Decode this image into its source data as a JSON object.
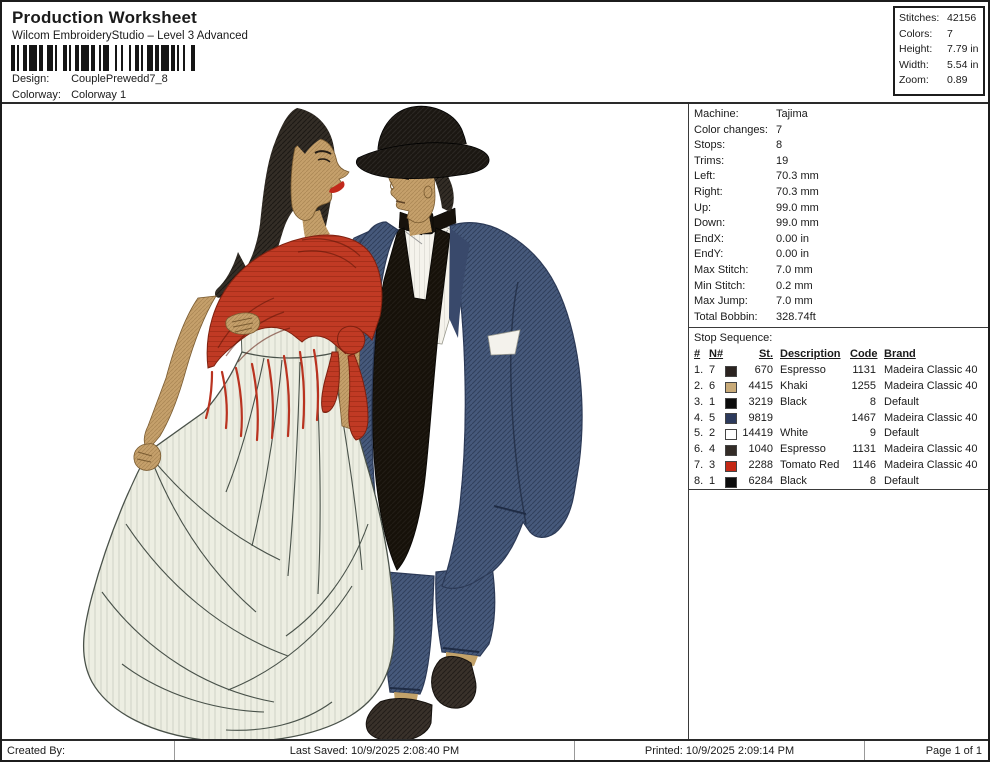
{
  "page": {
    "title": "Production Worksheet",
    "subtitle": "Wilcom EmbroideryStudio – Level 3 Advanced"
  },
  "design": {
    "label": "Design:",
    "value": "CouplePrewedd7_8"
  },
  "colorway": {
    "label": "Colorway:",
    "value": "Colorway 1"
  },
  "barcode": {
    "pattern": "2112214122311321122141221133121312211231214121121321"
  },
  "stats_box": {
    "rows": [
      {
        "label": "Stitches:",
        "value": "42156"
      },
      {
        "label": "Colors:",
        "value": "7"
      },
      {
        "label": "Height:",
        "value": "7.79 in"
      },
      {
        "label": "Width:",
        "value": "5.54 in"
      },
      {
        "label": "Zoom:",
        "value": "0.89"
      }
    ]
  },
  "machine_info": {
    "rows": [
      {
        "label": "Machine:",
        "value": "Tajima"
      },
      {
        "label": "Color changes:",
        "value": "7"
      },
      {
        "label": "Stops:",
        "value": "8"
      },
      {
        "label": "Trims:",
        "value": "19"
      },
      {
        "label": "Left:",
        "value": "70.3 mm"
      },
      {
        "label": "Right:",
        "value": "70.3 mm"
      },
      {
        "label": "Up:",
        "value": "99.0 mm"
      },
      {
        "label": "Down:",
        "value": "99.0 mm"
      },
      {
        "label": "EndX:",
        "value": "0.00 in"
      },
      {
        "label": "EndY:",
        "value": "0.00 in"
      },
      {
        "label": "Max Stitch:",
        "value": "7.0 mm"
      },
      {
        "label": "Min Stitch:",
        "value": "0.2 mm"
      },
      {
        "label": "Max Jump:",
        "value": "7.0 mm"
      },
      {
        "label": "Total Bobbin:",
        "value": "328.74ft"
      }
    ]
  },
  "stop_sequence": {
    "title": "Stop Sequence:",
    "headers": {
      "num": "#",
      "needle": "N#",
      "stitches": "St.",
      "description": "Description",
      "code": "Code",
      "brand": "Brand"
    },
    "rows": [
      {
        "num": "1.",
        "needle": "7",
        "color": "#2b2320",
        "st": "670",
        "description": "Espresso",
        "code": "1131",
        "brand": "Madeira Classic 40"
      },
      {
        "num": "2.",
        "needle": "6",
        "color": "#c8aa78",
        "st": "4415",
        "description": "Khaki",
        "code": "1255",
        "brand": "Madeira Classic 40"
      },
      {
        "num": "3.",
        "needle": "1",
        "color": "#0c0c0c",
        "st": "3219",
        "description": "Black",
        "code": "8",
        "brand": "Default"
      },
      {
        "num": "4.",
        "needle": "5",
        "color": "#2c3a5c",
        "st": "9819",
        "description": "",
        "code": "1467",
        "brand": "Madeira Classic 40"
      },
      {
        "num": "5.",
        "needle": "2",
        "color": "#ffffff",
        "st": "14419",
        "description": "White",
        "code": "9",
        "brand": "Default"
      },
      {
        "num": "6.",
        "needle": "4",
        "color": "#332c27",
        "st": "1040",
        "description": "Espresso",
        "code": "1131",
        "brand": "Madeira Classic 40"
      },
      {
        "num": "7.",
        "needle": "3",
        "color": "#c42815",
        "st": "2288",
        "description": "Tomato Red",
        "code": "1146",
        "brand": "Madeira Classic 40"
      },
      {
        "num": "8.",
        "needle": "1",
        "color": "#0c0c0c",
        "st": "6284",
        "description": "Black",
        "code": "8",
        "brand": "Default"
      }
    ]
  },
  "footer": {
    "created_by": "Created By:",
    "last_saved": "Last Saved: 10/9/2025 2:08:40 PM",
    "printed": "Printed: 10/9/2025 2:09:14 PM",
    "page_number": "Page 1 of 1"
  },
  "artwork": {
    "description": "Embroidered pre-wedding couple: woman with long dark hair, red shawl and flowing white gown walking arm in arm with man in hat, blue suit and black vest",
    "palette": {
      "skin": "#c5a06b",
      "hair": "#332d26",
      "shawl": "#bf3a24",
      "dress": "#edeee2",
      "suit": "#46597b",
      "vest": "#17120c",
      "hat": "#1b1712",
      "shoes": "#39312a"
    }
  }
}
